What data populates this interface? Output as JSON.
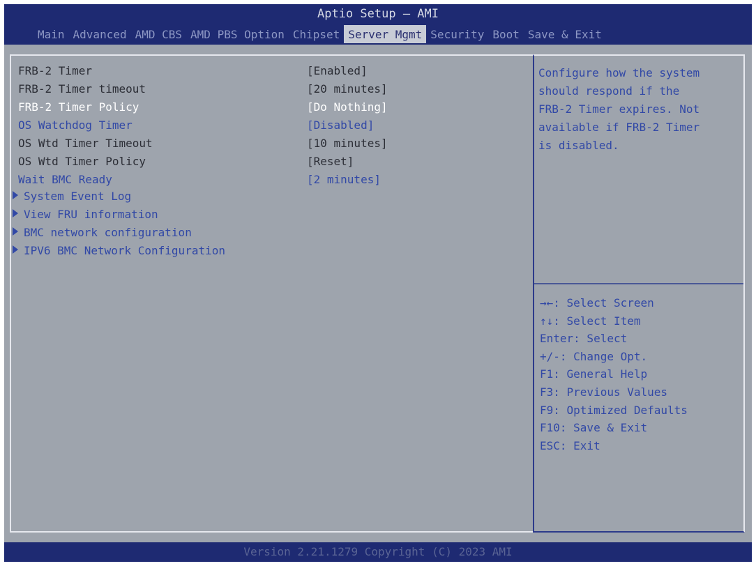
{
  "header": {
    "title": "Aptio Setup – AMI",
    "tabs": [
      {
        "label": "Main"
      },
      {
        "label": "Advanced"
      },
      {
        "label": "AMD CBS"
      },
      {
        "label": "AMD PBS Option"
      },
      {
        "label": "Chipset"
      },
      {
        "label": "Server Mgmt",
        "active": true
      },
      {
        "label": "Security"
      },
      {
        "label": "Boot"
      },
      {
        "label": "Save & Exit"
      }
    ]
  },
  "settings": [
    {
      "label": "FRB-2 Timer",
      "value": "[Enabled]"
    },
    {
      "label": "FRB-2 Timer timeout",
      "value": "[20 minutes]"
    },
    {
      "label": "FRB-2 Timer Policy",
      "value": "[Do Nothing]",
      "selected": true
    },
    {
      "label": "OS Watchdog Timer",
      "value": "[Disabled]"
    },
    {
      "label": "OS Wtd Timer Timeout",
      "value": "[10 minutes]"
    },
    {
      "label": "OS Wtd Timer Policy",
      "value": "[Reset]"
    },
    {
      "label": "Wait BMC Ready",
      "value": "[2 minutes]"
    }
  ],
  "submenus": [
    {
      "label": "System Event Log"
    },
    {
      "label": "View FRU information"
    },
    {
      "label": "BMC network configuration"
    },
    {
      "label": "IPV6 BMC Network Configuration"
    }
  ],
  "help": {
    "lines": [
      "Configure how the system",
      "should respond if the",
      "FRB-2 Timer expires. Not",
      "available if FRB-2 Timer",
      "is disabled."
    ]
  },
  "keys": [
    "→←: Select Screen",
    "↑↓: Select Item",
    "Enter: Select",
    "+/-: Change Opt.",
    "F1: General Help",
    "F3: Previous Values",
    "F9: Optimized Defaults",
    "F10: Save & Exit",
    "ESC: Exit"
  ],
  "footer": {
    "text": "Version 2.21.1279 Copyright (C) 2023 AMI"
  },
  "colors": {
    "background": "#9ea4ad",
    "title_bar": "#1e2a72",
    "active_tab": "#c8ccd6",
    "highlight_text": "#3148a6",
    "selected_text": "#ffffff"
  }
}
